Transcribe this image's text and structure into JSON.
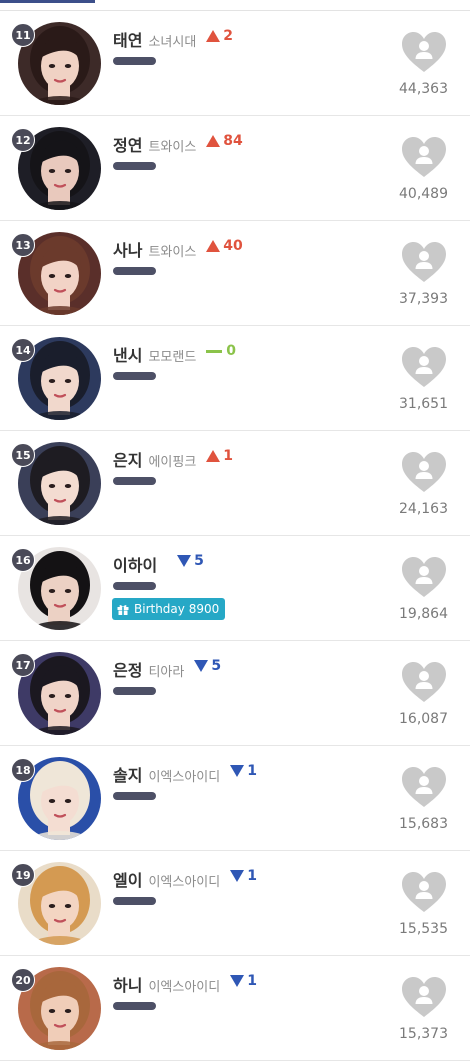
{
  "ranking": [
    {
      "rank": "11",
      "name": "태연",
      "group": "소녀시대",
      "change_dir": "up",
      "change": "2",
      "votes": "44,363",
      "photo": {
        "bg": "#3d2a28",
        "hair": "#2a1a18",
        "skin": "#f0d2c4"
      }
    },
    {
      "rank": "12",
      "name": "정연",
      "group": "트와이스",
      "change_dir": "up",
      "change": "84",
      "votes": "40,489",
      "photo": {
        "bg": "#1e1e26",
        "hair": "#151418",
        "skin": "#e9c9bd"
      }
    },
    {
      "rank": "13",
      "name": "사나",
      "group": "트와이스",
      "change_dir": "up",
      "change": "40",
      "votes": "37,393",
      "photo": {
        "bg": "#5a2f2a",
        "hair": "#6b3a2c",
        "skin": "#f2d3c6"
      }
    },
    {
      "rank": "14",
      "name": "낸시",
      "group": "모모랜드",
      "change_dir": "same",
      "change": "0",
      "votes": "31,651",
      "photo": {
        "bg": "#2d3a5e",
        "hair": "#1a1e2c",
        "skin": "#f1d8cc"
      }
    },
    {
      "rank": "15",
      "name": "은지",
      "group": "에이핑크",
      "change_dir": "up",
      "change": "1",
      "votes": "24,163",
      "photo": {
        "bg": "#3a3f58",
        "hair": "#1e1c22",
        "skin": "#f3dcd1"
      }
    },
    {
      "rank": "16",
      "name": "이하이",
      "group": "",
      "change_dir": "down",
      "change": "5",
      "votes": "19,864",
      "birthday": "Birthday 8900",
      "photo": {
        "bg": "#e8e4e2",
        "hair": "#141214",
        "skin": "#ecd1c4"
      }
    },
    {
      "rank": "17",
      "name": "은정",
      "group": "티아라",
      "change_dir": "down",
      "change": "5",
      "votes": "16,087",
      "photo": {
        "bg": "#3e3a66",
        "hair": "#1b1820",
        "skin": "#f0d4c8"
      }
    },
    {
      "rank": "18",
      "name": "솔지",
      "group": "이엑스아이디",
      "change_dir": "down",
      "change": "1",
      "votes": "15,683",
      "photo": {
        "bg": "#2a4fa8",
        "hair": "#efe6d8",
        "skin": "#f4ddd2"
      }
    },
    {
      "rank": "19",
      "name": "엘이",
      "group": "이엑스아이디",
      "change_dir": "down",
      "change": "1",
      "votes": "15,535",
      "photo": {
        "bg": "#e9dcc8",
        "hair": "#d49a52",
        "skin": "#f3d5c2"
      }
    },
    {
      "rank": "20",
      "name": "하니",
      "group": "이엑스아이디",
      "change_dir": "down",
      "change": "1",
      "votes": "15,373",
      "photo": {
        "bg": "#b86a4a",
        "hair": "#a8673c",
        "skin": "#f0cdb8"
      }
    }
  ],
  "colors": {
    "up": "#e0533e",
    "down": "#2f57b5",
    "same": "#8bc34a",
    "heart": "#c9c9c9",
    "birthday": "#26a8c6"
  }
}
